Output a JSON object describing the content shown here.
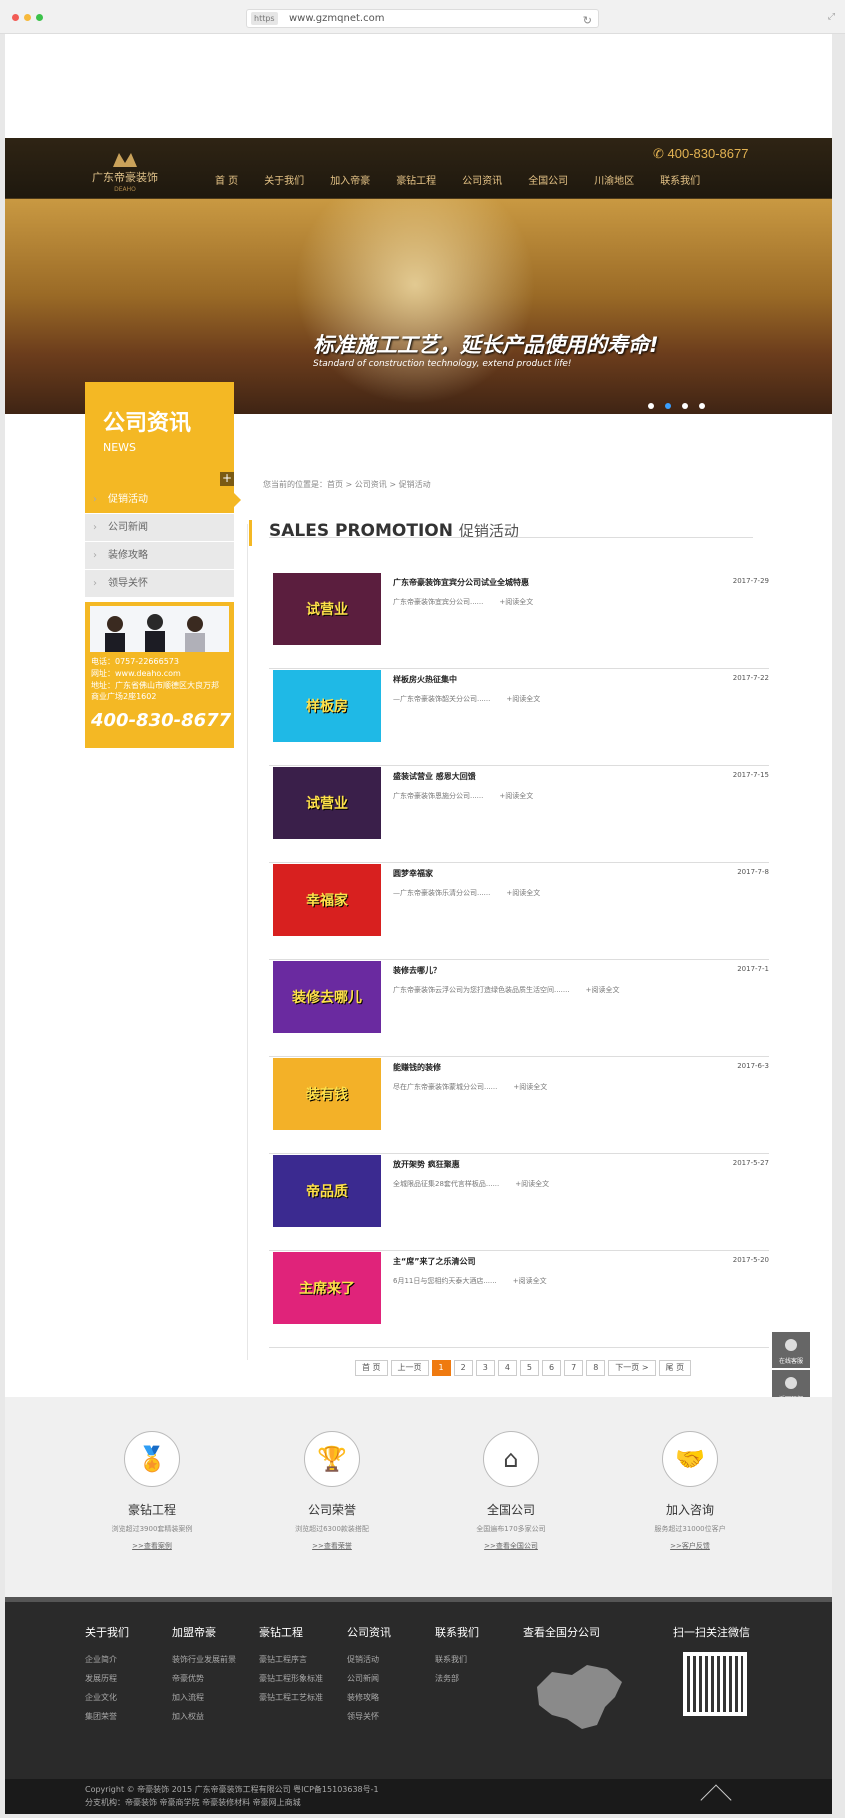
{
  "browser": {
    "https": "https",
    "url": "www.gzmqnet.com"
  },
  "header": {
    "logo_cn": "广东帝豪装饰",
    "logo_en": "DEAHO",
    "phone": "400-830-8677",
    "nav": [
      "首 页",
      "关于我们",
      "加入帝豪",
      "豪钻工程",
      "公司资讯",
      "全国公司",
      "川渝地区",
      "联系我们"
    ]
  },
  "banner": {
    "slogan": "标准施工工艺，延长产品使用的寿命!",
    "slogan_en": "Standard of construction technology, extend product life!"
  },
  "news_box": {
    "title": "公司资讯",
    "subtitle": "NEWS",
    "plus": "+"
  },
  "sidebar": {
    "items": [
      {
        "label": "促销活动",
        "active": true
      },
      {
        "label": "公司新闻"
      },
      {
        "label": "装修攻略"
      },
      {
        "label": "领导关怀"
      }
    ]
  },
  "contact": {
    "tel": "电话：0757-22666573",
    "web": "网址：www.deaho.com",
    "addr1": "地址：广东省佛山市顺德区大良万邦",
    "addr2": "商业广场2座1602",
    "phone": "400-830-8677"
  },
  "breadcrumb": "您当前的位置是：首页 > 公司资讯 > 促销活动",
  "section": {
    "title_en": "SALES PROMOTION",
    "title_cn": "促销活动"
  },
  "read_more": "+阅读全文",
  "news": [
    {
      "title": "广东帝豪装饰宜宾分公司试业全城特惠",
      "desc": "广东帝豪装饰宜宾分公司......",
      "date": "2017-7-29",
      "thumb_text": "试营业",
      "color": "#5b1e3e"
    },
    {
      "title": "样板房火热征集中",
      "desc": "—广东帝豪装饰韶关分公司......",
      "date": "2017-7-22",
      "thumb_text": "样板房",
      "color": "#1fb9e6"
    },
    {
      "title": "盛装试营业 感恩大回馈",
      "desc": "广东帝豪装饰恩施分公司......",
      "date": "2017-7-15",
      "thumb_text": "试营业",
      "color": "#3a1f4a"
    },
    {
      "title": "圆梦幸福家",
      "desc": "—广东帝豪装饰乐清分公司......",
      "date": "2017-7-8",
      "thumb_text": "幸福家",
      "color": "#d8201f"
    },
    {
      "title": "装修去哪儿？",
      "desc": "广东帝豪装饰云浮公司为您打造绿色装品质生活空间.......",
      "date": "2017-7-1",
      "thumb_text": "装修去哪儿",
      "color": "#6a2aa0"
    },
    {
      "title": "能赚钱的装修",
      "desc": "尽在广东帝豪装饰蒙城分公司......",
      "date": "2017-6-3",
      "thumb_text": "装有钱",
      "color": "#f3b128"
    },
    {
      "title": "放开架势 疯狂聚惠",
      "desc": "全城限品征集28套代言样板品......",
      "date": "2017-5-27",
      "thumb_text": "帝品质",
      "color": "#3b2a90"
    },
    {
      "title": "主“席”来了之乐清公司",
      "desc": "6月11日与您相约天泰大酒店......",
      "date": "2017-5-20",
      "thumb_text": "主席来了",
      "color": "#e0237a"
    }
  ],
  "pager": [
    "首 页",
    "上一页",
    "1",
    "2",
    "3",
    "4",
    "5",
    "6",
    "7",
    "8",
    "下一页 >",
    "尾 页"
  ],
  "float": [
    "在线客服",
    "返回顶部"
  ],
  "services": [
    {
      "icon": "medal-icon",
      "glyph": "🏅",
      "title": "豪钻工程",
      "desc": "浏览超过3900套精装案例",
      "link": ">>查看案例"
    },
    {
      "icon": "trophy-icon",
      "glyph": "🏆",
      "title": "公司荣誉",
      "desc": "浏览超过6300款装搭配",
      "link": ">>查看荣誉"
    },
    {
      "icon": "home-icon",
      "glyph": "⌂",
      "title": "全国公司",
      "desc": "全国遍布170多家公司",
      "link": ">>查看全国公司"
    },
    {
      "icon": "handshake-icon",
      "glyph": "🤝",
      "title": "加入咨询",
      "desc": "服务超过31000位客户",
      "link": ">>客户反馈"
    }
  ],
  "footer": {
    "cols": [
      {
        "title": "关于我们",
        "items": [
          "企业简介",
          "发展历程",
          "企业文化",
          "集团荣誉"
        ]
      },
      {
        "title": "加盟帝豪",
        "items": [
          "装饰行业发展前景",
          "帝豪优势",
          "加入流程",
          "加入权益"
        ]
      },
      {
        "title": "豪钻工程",
        "items": [
          "豪钻工程序言",
          "豪钻工程形象标准",
          "豪钻工程工艺标准"
        ]
      },
      {
        "title": "公司资讯",
        "items": [
          "促销活动",
          "公司新闻",
          "装修攻略",
          "领导关怀"
        ]
      },
      {
        "title": "联系我们",
        "items": [
          "联系我们",
          "法务部"
        ]
      },
      {
        "title": "查看全国分公司",
        "items": []
      },
      {
        "title": "扫一扫关注微信",
        "items": []
      }
    ],
    "copyright": "Copyright © 帝豪装饰 2015 广东帝豪装饰工程有限公司 粤ICP备15103638号-1",
    "branches": "分支机构：帝豪装饰   帝豪商学院   帝豪装修材料   帝豪网上商城"
  }
}
